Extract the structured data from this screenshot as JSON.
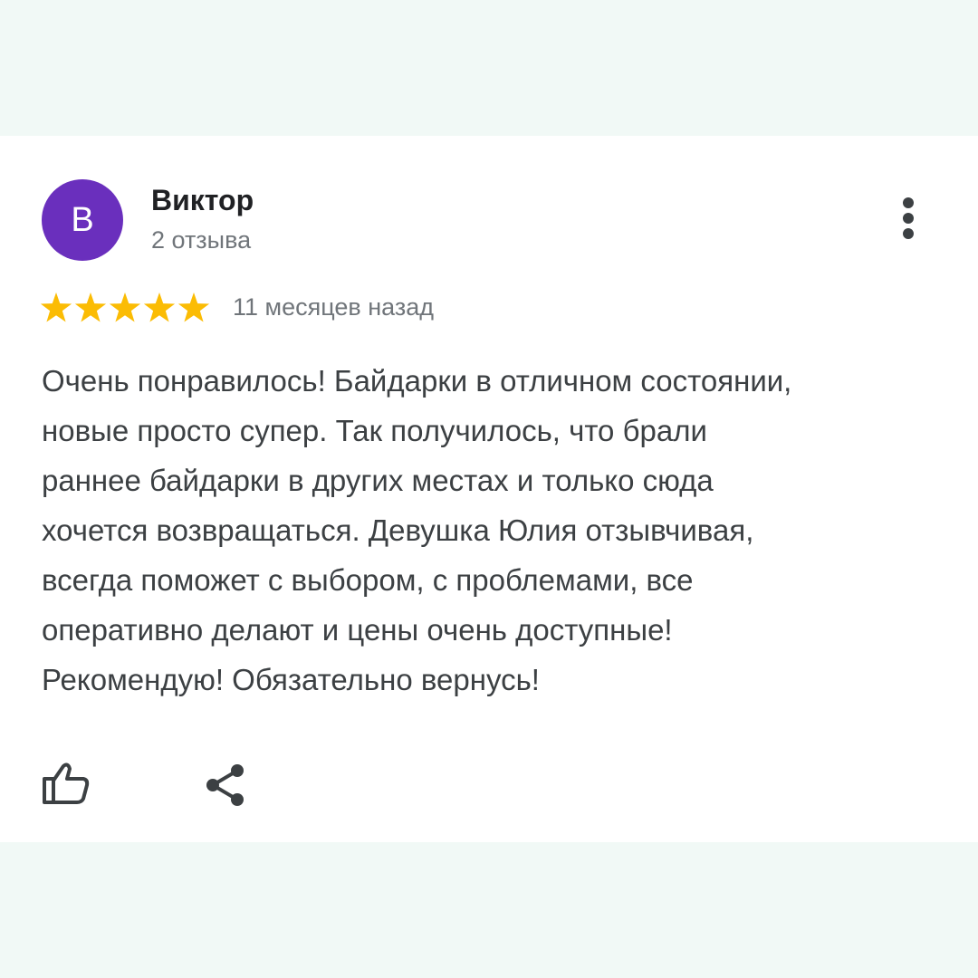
{
  "review": {
    "avatar_letter": "В",
    "author": "Виктор",
    "review_count": "2 отзыва",
    "rating": 5,
    "rating_max": 5,
    "time_ago": "11 месяцев назад",
    "text": "Очень понравилось! Байдарки в отличном состоянии,\nновые просто супер. Так получилось, что брали\nраннее байдарки в других местах и только сюда\nхочется возвращаться. Девушка Юлия отзывчивая,\nвсегда поможет с выбором, с проблемами, все\nоперативно делают и цены очень доступные!\nРекомендую! Обязательно вернусь!"
  },
  "icons": {
    "menu": "more-vertical-icon",
    "star": "star-icon",
    "like": "thumbs-up-icon",
    "share": "share-icon"
  },
  "colors": {
    "background": "#f1f9f6",
    "card": "#ffffff",
    "avatar": "#6a2fbd",
    "star": "#fbbc04",
    "text": "#3c4043",
    "muted": "#70757a"
  }
}
